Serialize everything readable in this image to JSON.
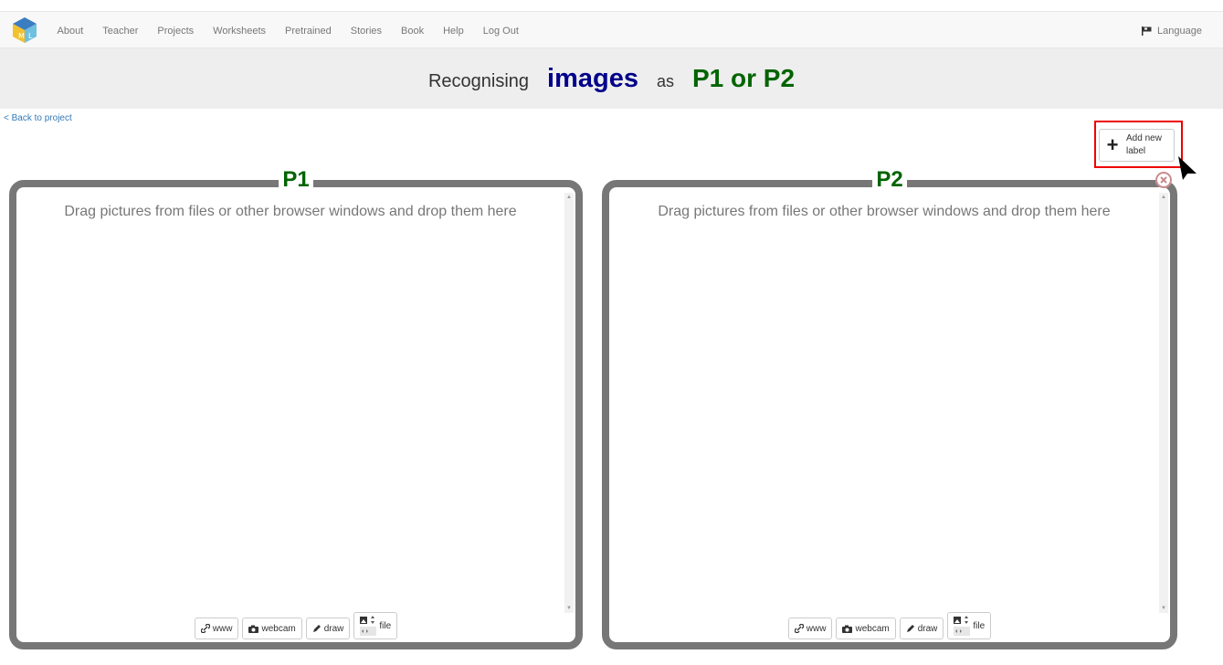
{
  "nav": {
    "items": [
      "About",
      "Teacher",
      "Projects",
      "Worksheets",
      "Pretrained",
      "Stories",
      "Book",
      "Help",
      "Log Out"
    ],
    "language": "Language"
  },
  "title": {
    "prefix": "Recognising",
    "type": "images",
    "as": "as",
    "labels": "P1 or P2"
  },
  "back_link": "< Back to project",
  "add_label": {
    "line1": "Add new",
    "line2": "label"
  },
  "buckets": [
    {
      "label": "P1",
      "drop_text": "Drag pictures from files or other browser windows and drop them here",
      "buttons": {
        "www": "www",
        "webcam": "webcam",
        "draw": "draw",
        "file": "file"
      }
    },
    {
      "label": "P2",
      "drop_text": "Drag pictures from files or other browser windows and drop them here",
      "buttons": {
        "www": "www",
        "webcam": "webcam",
        "draw": "draw",
        "file": "file"
      }
    }
  ],
  "colors": {
    "type_color": "#00008b",
    "label_color": "#006400",
    "link_color": "#337ab7",
    "highlight": "#ee0000",
    "bucket_border": "#777777"
  },
  "icons": [
    "logo-icon",
    "flag-icon",
    "plus-icon",
    "link-icon",
    "camera-icon",
    "pencil-icon",
    "file-icon",
    "delete-icon",
    "cursor-icon"
  ]
}
